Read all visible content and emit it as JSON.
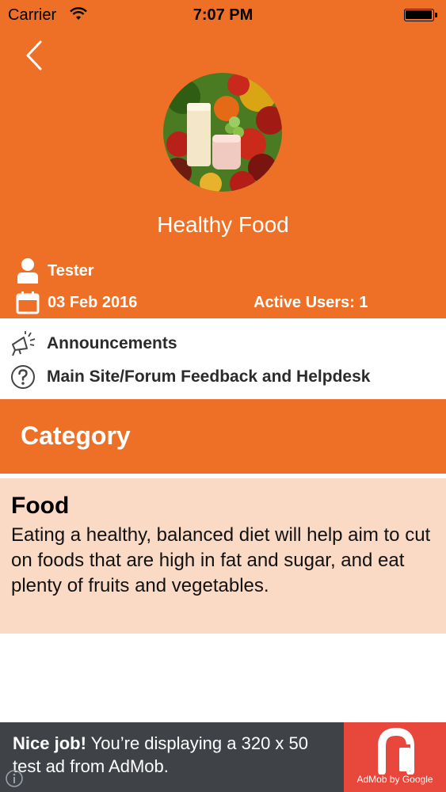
{
  "status_bar": {
    "carrier": "Carrier",
    "time": "7:07 PM"
  },
  "group": {
    "title": "Healthy Food",
    "author": "Tester",
    "date": "03 Feb 2016",
    "active_users": "Active Users: 1"
  },
  "links": {
    "announcements": "Announcements",
    "feedback": "Main Site/Forum Feedback and Helpdesk"
  },
  "category_section": {
    "title": "Category"
  },
  "category": {
    "name": "Food",
    "description": "Eating a healthy, balanced diet will help aim to cut on foods that are high in fat and sugar, and eat plenty of fruits and vegetables."
  },
  "ad": {
    "headline": "Nice job!",
    "text": " You’re displaying a 320 x 50 test ad from AdMob.",
    "attribution": "AdMob by Google"
  },
  "colors": {
    "accent": "#EE7026",
    "card": "#FBDAC5",
    "ad_bg": "#3F4347",
    "ad_logo": "#E8473B"
  }
}
